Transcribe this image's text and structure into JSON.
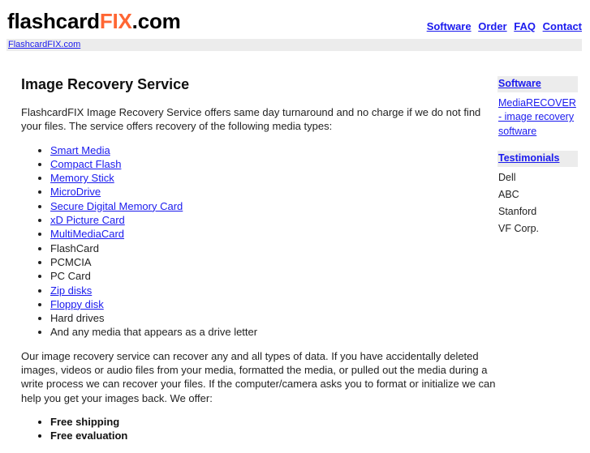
{
  "header": {
    "logo_part1": "flashcard",
    "logo_part2": "FIX",
    "logo_part3": ".com",
    "nav": [
      {
        "label": "Software"
      },
      {
        "label": "Order"
      },
      {
        "label": "FAQ"
      },
      {
        "label": "Contact"
      }
    ]
  },
  "breadcrumb": {
    "home": "FlashcardFIX.com"
  },
  "main": {
    "title": "Image Recovery Service",
    "intro": "FlashcardFIX Image Recovery Service offers same day turnaround and no charge if we do not find your files. The service offers recovery of the following media types:",
    "media_types": [
      {
        "label": "Smart Media",
        "link": true
      },
      {
        "label": "Compact Flash",
        "link": true
      },
      {
        "label": "Memory Stick",
        "link": true
      },
      {
        "label": "MicroDrive",
        "link": true
      },
      {
        "label": "Secure Digital Memory Card",
        "link": true
      },
      {
        "label": "xD Picture Card",
        "link": true
      },
      {
        "label": "MultiMediaCard",
        "link": true
      },
      {
        "label": "FlashCard",
        "link": false
      },
      {
        "label": "PCMCIA",
        "link": false
      },
      {
        "label": "PC Card",
        "link": false
      },
      {
        "label": "Zip disks",
        "link": true
      },
      {
        "label": "Floppy disk",
        "link": true
      },
      {
        "label": "Hard drives",
        "link": false
      },
      {
        "label": "And any media that appears as a drive letter",
        "link": false
      }
    ],
    "description": "Our image recovery service can recover any and all types of data. If you have accidentally deleted images, videos or audio files from your media, formatted the media, or pulled out the media during a write process we can recover your files. If the computer/camera asks you to format or initialize we can help you get your images back. We offer:",
    "offers": [
      "Free shipping",
      "Free evaluation"
    ]
  },
  "sidebar": {
    "software_heading": "Software",
    "software_link": "MediaRECOVER - image recovery software",
    "testimonials_heading": "Testimonials",
    "testimonials": [
      "Dell",
      "ABC",
      "Stanford",
      "VF Corp."
    ]
  },
  "colors": {
    "accent": "#ff6633",
    "link": "#1a1aee",
    "bar_bg": "#ececec"
  }
}
